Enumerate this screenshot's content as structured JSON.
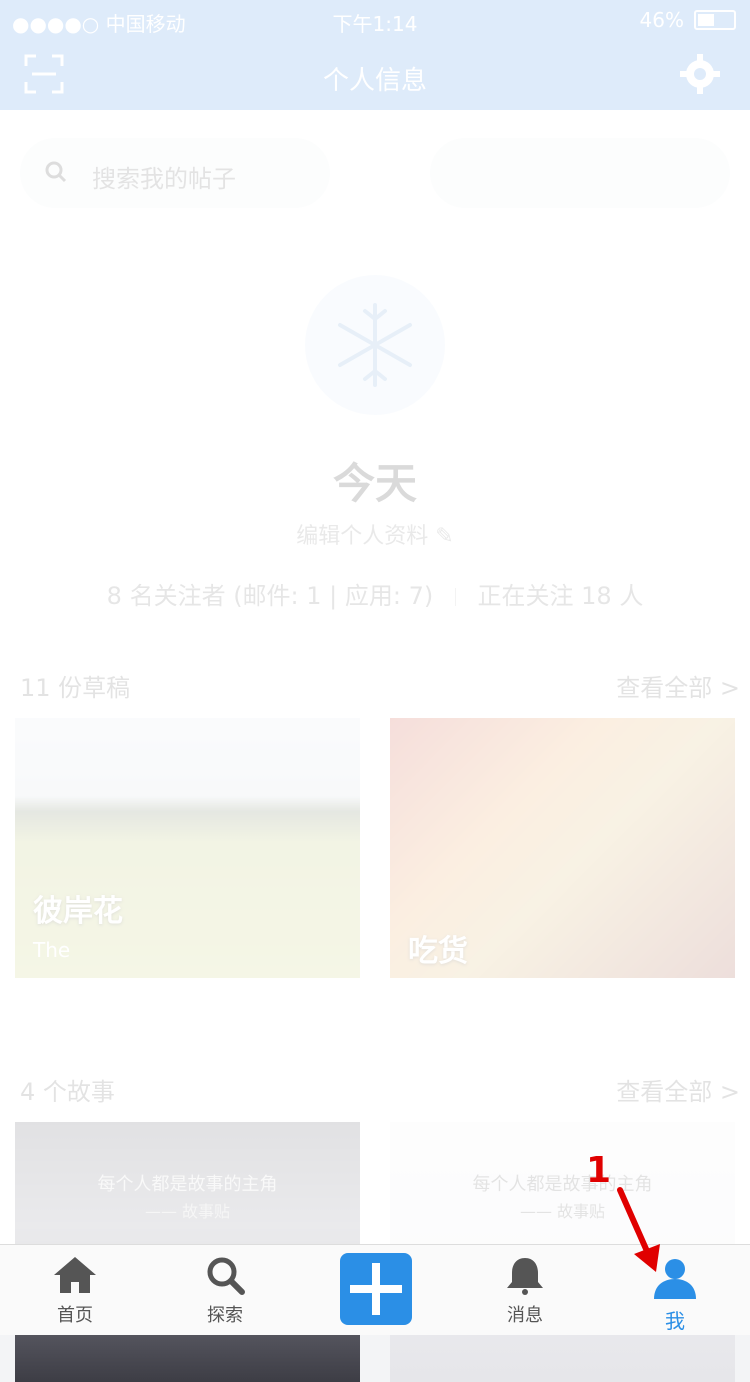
{
  "status_bar": {
    "carrier": "●●●●○ 中国移动",
    "time": "下午1:14",
    "battery": "46%",
    "battery_level": 0.46
  },
  "nav": {
    "title": "个人信息",
    "left_icon": "scan-icon",
    "right_icon": "gear-icon"
  },
  "search": {
    "placeholder": "搜索我的帖子",
    "icon": "search-icon"
  },
  "profile": {
    "avatar_icon": "snowflake-icon",
    "name": "今天",
    "edit_label": "编辑个人资料",
    "followers_text": "8 名关注者 (邮件: 1 | 应用: 7)",
    "following_text": "正在关注 18 人"
  },
  "drafts": {
    "title": "11 份草稿",
    "view_all": "查看全部 >",
    "cards": [
      {
        "title": "彼岸花",
        "subtitle": "The"
      },
      {
        "title": "吃货",
        "subtitle": ""
      }
    ]
  },
  "stories": {
    "title": "4 个故事",
    "view_all": "查看全部 >",
    "cards": [
      {
        "quote": "每个人都是故事的主角",
        "sig": "—— 故事贴"
      },
      {
        "quote": "每个人都是故事的主角",
        "sig": "—— 故事贴"
      }
    ]
  },
  "tabbar": {
    "items": [
      {
        "label": "首页",
        "icon": "home-icon"
      },
      {
        "label": "探索",
        "icon": "search-icon"
      },
      {
        "label": "",
        "icon": "plus-icon"
      },
      {
        "label": "消息",
        "icon": "bell-icon"
      },
      {
        "label": "我",
        "icon": "person-icon"
      }
    ]
  },
  "annotation": {
    "number": "1"
  },
  "colors": {
    "brand": "#4a90e2",
    "active_tab": "#2b8fe6",
    "annotation": "#e00000"
  }
}
